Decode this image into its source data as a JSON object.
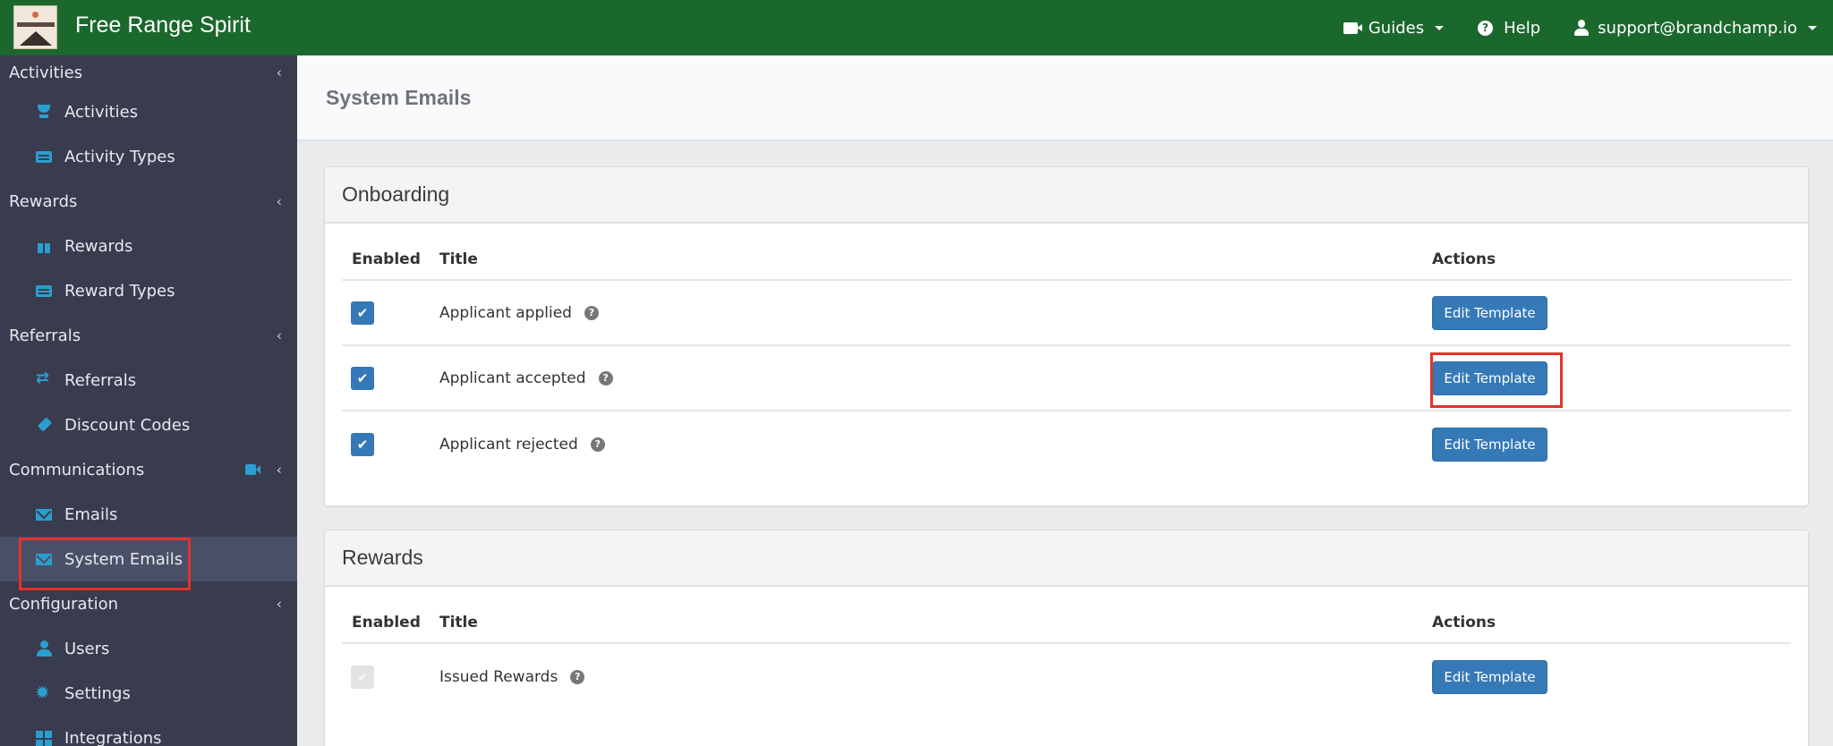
{
  "topbar": {
    "brand": "Free Range Spirit",
    "guides_label": "Guides",
    "help_label": "Help",
    "user_label": "support@brandchamp.io",
    "color": "#1b682d"
  },
  "sidebar": {
    "sections": [
      {
        "label": "Activities",
        "items": [
          {
            "label": "Activities",
            "icon": "trophy-icon"
          },
          {
            "label": "Activity Types",
            "icon": "list-icon"
          }
        ]
      },
      {
        "label": "Rewards",
        "items": [
          {
            "label": "Rewards",
            "icon": "gift-icon"
          },
          {
            "label": "Reward Types",
            "icon": "list-icon"
          }
        ]
      },
      {
        "label": "Referrals",
        "items": [
          {
            "label": "Referrals",
            "icon": "retweet-icon"
          },
          {
            "label": "Discount Codes",
            "icon": "ticket-icon"
          }
        ]
      },
      {
        "label": "Communications",
        "items": [
          {
            "label": "Emails",
            "icon": "envelope-icon"
          },
          {
            "label": "System Emails",
            "icon": "envelope-icon",
            "active": true
          }
        ]
      },
      {
        "label": "Configuration",
        "items": [
          {
            "label": "Users",
            "icon": "user-icon"
          },
          {
            "label": "Settings",
            "icon": "cog-icon"
          },
          {
            "label": "Integrations",
            "icon": "grid-icon"
          }
        ]
      }
    ]
  },
  "page": {
    "title": "System Emails"
  },
  "panels": [
    {
      "title": "Onboarding",
      "columns": [
        "Enabled",
        "Title",
        "Actions"
      ],
      "rows": [
        {
          "enabled": true,
          "title": "Applicant applied",
          "action": "Edit Template"
        },
        {
          "enabled": true,
          "title": "Applicant accepted",
          "action": "Edit Template"
        },
        {
          "enabled": true,
          "title": "Applicant rejected",
          "action": "Edit Template"
        }
      ]
    },
    {
      "title": "Rewards",
      "columns": [
        "Enabled",
        "Title",
        "Actions"
      ],
      "rows": [
        {
          "enabled": true,
          "disabled": true,
          "title": "Issued Rewards",
          "action": "Edit Template"
        }
      ]
    }
  ],
  "icons": {
    "check": "✔",
    "help": "?",
    "chevron": "‹"
  }
}
